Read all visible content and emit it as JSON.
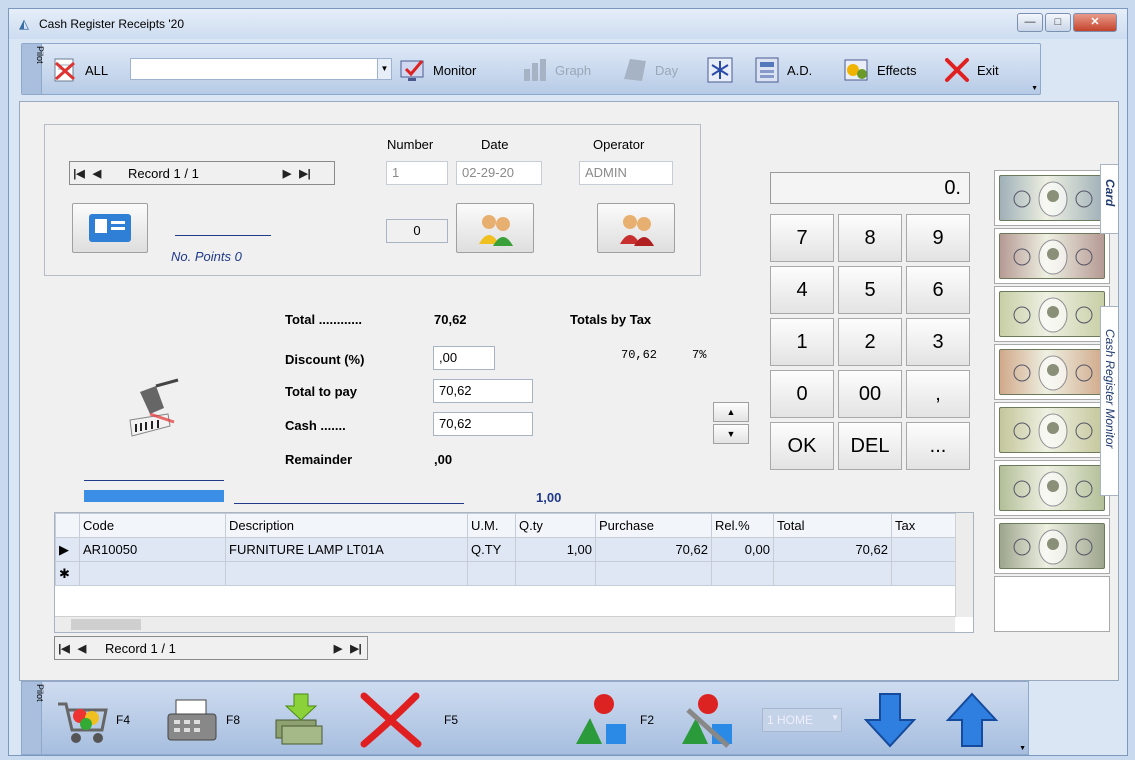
{
  "window": {
    "title": "Cash Register Receipts  '20",
    "min": "—",
    "max": "□",
    "close": "✕"
  },
  "toolbar": {
    "pilot": "Pilot",
    "all_label": "ALL",
    "combo_value": "",
    "monitor": "Monitor",
    "graph": "Graph",
    "day": "Day",
    "ad": "A.D.",
    "effects": "Effects",
    "exit": "Exit"
  },
  "record": {
    "nav_label": "Record 1 / 1",
    "number_label": "Number",
    "date_label": "Date",
    "operator_label": "Operator",
    "number": "1",
    "date": "02-29-20",
    "operator": "ADMIN",
    "count": "0",
    "points": "No. Points 0"
  },
  "totals": {
    "total_label": "Total ............",
    "total_value": "70,62",
    "by_tax_label": "Totals by Tax",
    "tax_amount": "70,62",
    "tax_rate": "7%",
    "discount_label": "Discount (%)",
    "discount_value": ",00",
    "topay_label": "Total to pay",
    "topay_value": "70,62",
    "cash_label": "Cash .......",
    "cash_value": "70,62",
    "remainder_label": "Remainder",
    "remainder_value": ",00",
    "progress_value": "1,00"
  },
  "keypad": {
    "display": "0.",
    "keys": [
      "7",
      "8",
      "9",
      "4",
      "5",
      "6",
      "1",
      "2",
      "3",
      "0",
      "00",
      ",",
      "OK",
      "DEL",
      "..."
    ]
  },
  "side_tabs": {
    "card": "Card",
    "monitor": "Cash Register Monitor"
  },
  "grid": {
    "columns": [
      "Code",
      "Description",
      "U.M.",
      "Q.ty",
      "Purchase",
      "Rel.%",
      "Total",
      "Tax"
    ],
    "rows": [
      {
        "code": "AR10050",
        "description": "FURNITURE LAMP LT01A",
        "um": "Q.TY",
        "qty": "1,00",
        "purchase": "70,62",
        "rel": "0,00",
        "total": "70,62",
        "tax": ""
      }
    ],
    "nav_label": "Record 1 / 1"
  },
  "bottombar": {
    "pilot": "Pilot",
    "f4": "F4",
    "f8": "F8",
    "f5": "F5",
    "f2": "F2",
    "home_combo": "1 HOME"
  },
  "colors": {
    "accent": "#3a8ee6",
    "link_blue": "#1f3a8a",
    "exit_red": "#d22",
    "money_green": "#8aa27a"
  }
}
